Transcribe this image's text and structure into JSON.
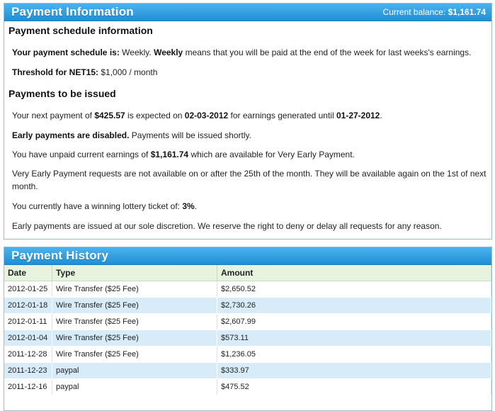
{
  "info": {
    "title": "Payment Information",
    "balance_label": "Current balance:",
    "balance_value": "$1,161.74",
    "schedule_heading": "Payment schedule information",
    "schedule_label": "Your payment schedule is:",
    "schedule_value": "Weekly.",
    "schedule_bold": "Weekly",
    "schedule_desc": "means that you will be paid at the end of the week for last weeks's earnings.",
    "threshold_label": "Threshold for NET15:",
    "threshold_value": "$1,000 / month",
    "issued_heading": "Payments to be issued",
    "next_pre": "Your next payment of",
    "next_amount": "$425.57",
    "next_mid": "is expected on",
    "next_date": "02-03-2012",
    "next_mid2": "for earnings generated until",
    "next_until": "01-27-2012",
    "next_end": ".",
    "early_bold": "Early payments are disabled.",
    "early_rest": "Payments will be issued shortly.",
    "unpaid_pre": "You have unpaid current earnings of",
    "unpaid_amount": "$1,161.74",
    "unpaid_post": "which are available for Very Early Payment.",
    "very_early": "Very Early Payment requests are not available on or after the 25th of the month. They will be available again on the 1st of next month.",
    "lottery_pre": "You currently have a winning lottery ticket of:",
    "lottery_value": "3%",
    "lottery_end": ".",
    "discretion": "Early payments are issued at our sole discretion. We reserve the right to deny or delay all requests for any reason."
  },
  "history": {
    "title": "Payment History",
    "columns": [
      "Date",
      "Type",
      "Amount"
    ],
    "rows": [
      [
        "2012-01-25",
        "Wire Transfer ($25 Fee)",
        "$2,650.52"
      ],
      [
        "2012-01-18",
        "Wire Transfer ($25 Fee)",
        "$2,730.26"
      ],
      [
        "2012-01-11",
        "Wire Transfer ($25 Fee)",
        "$2,607.99"
      ],
      [
        "2012-01-04",
        "Wire Transfer ($25 Fee)",
        "$573.11"
      ],
      [
        "2011-12-28",
        "Wire Transfer ($25 Fee)",
        "$1,236.05"
      ],
      [
        "2011-12-23",
        "paypal",
        "$333.97"
      ],
      [
        "2011-12-16",
        "paypal",
        "$475.52"
      ]
    ]
  }
}
